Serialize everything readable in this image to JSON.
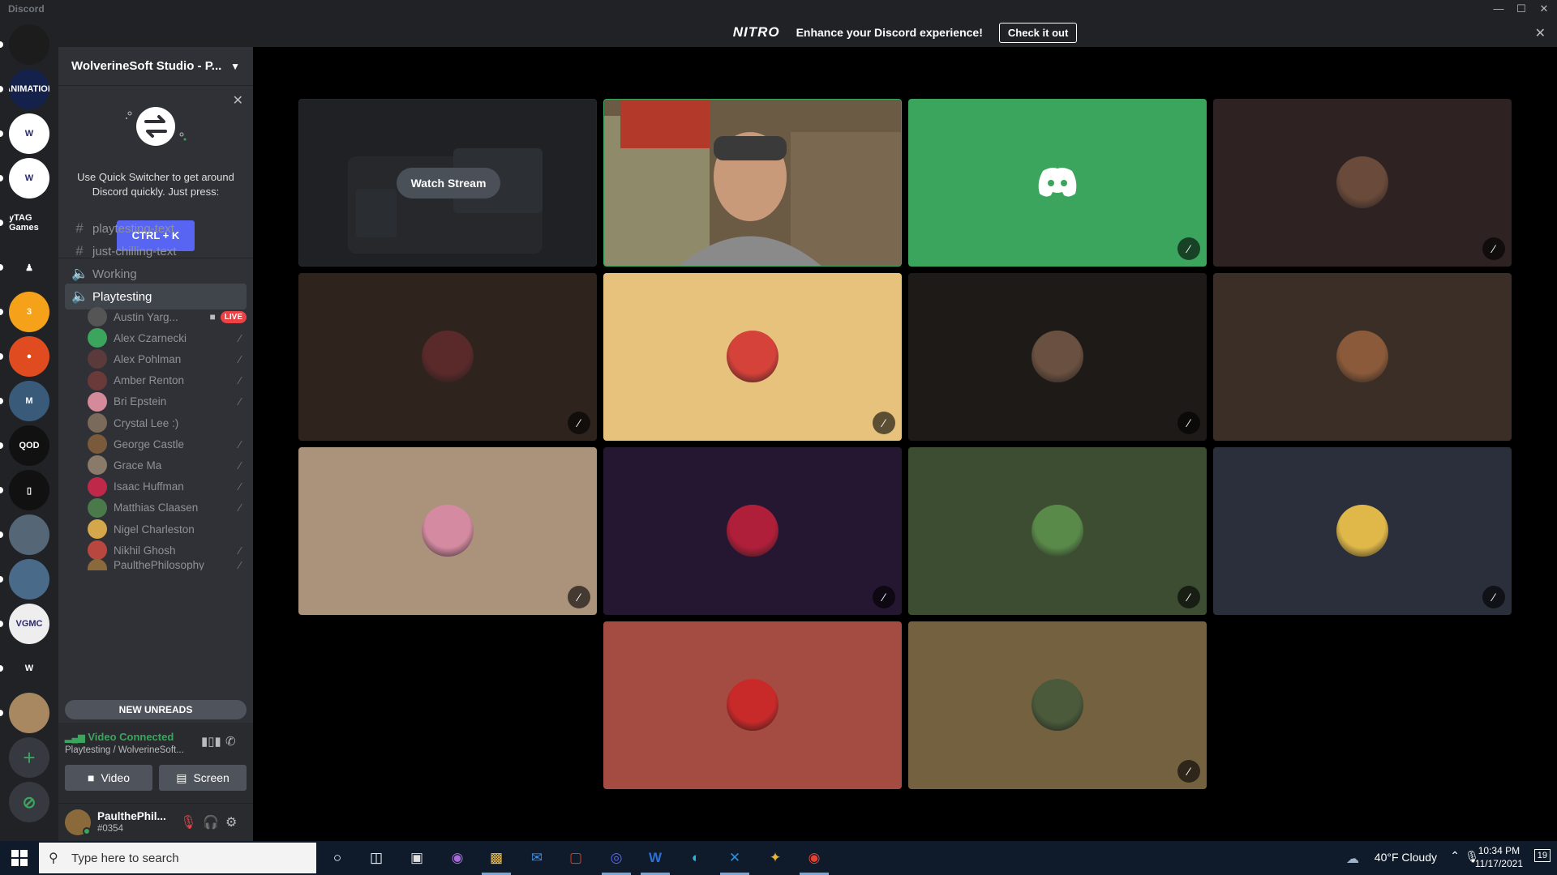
{
  "window": {
    "title": "Discord",
    "controls": [
      "—",
      "☐",
      "✕"
    ]
  },
  "nitro_banner": {
    "logo": "NITRO",
    "message": "Enhance your Discord experience!",
    "cta": "Check it out",
    "close": "✕"
  },
  "servers": [
    {
      "name": "server-1",
      "color": "#1c1c1c",
      "label": ""
    },
    {
      "name": "animation-club",
      "color": "#14214a",
      "label": "ANIMATION"
    },
    {
      "name": "wolverinesoft-1",
      "color": "#ffffff",
      "label": "W"
    },
    {
      "name": "wolverinesoft-2",
      "color": "#ffffff",
      "label": "W"
    },
    {
      "name": "ytag-games",
      "color": "#202225",
      "label": "yTAG Games"
    },
    {
      "name": "chess",
      "color": "#202225",
      "label": "♟"
    },
    {
      "name": "fire",
      "color": "#f5a21a",
      "label": "3"
    },
    {
      "name": "pizza",
      "color": "#e04b1f",
      "label": "●"
    },
    {
      "name": "michigan",
      "color": "#3a5a7a",
      "label": "M"
    },
    {
      "name": "pixel",
      "color": "#111111",
      "label": "QOD"
    },
    {
      "name": "frame",
      "color": "#111111",
      "label": "▯"
    },
    {
      "name": "photo",
      "color": "#556677",
      "label": ""
    },
    {
      "name": "mountain",
      "color": "#4a6a8a",
      "label": ""
    },
    {
      "name": "vgmc",
      "color": "#eeeeee",
      "label": "VGMC"
    },
    {
      "name": "w-blue",
      "color": "#202225",
      "label": "W"
    },
    {
      "name": "photo-2",
      "color": "#a88860",
      "label": ""
    }
  ],
  "rail_actions": {
    "add": "+",
    "explore": "⊘"
  },
  "sidebar": {
    "guild_name": "WolverineSoft Studio - P...",
    "quick_switcher": {
      "text": "Use Quick Switcher to get around Discord quickly. Just press:",
      "button": "CTRL + K"
    },
    "channels": [
      {
        "icon": "#",
        "type": "text",
        "name": "playtesting-text"
      },
      {
        "icon": "#",
        "type": "text",
        "name": "just-chilling-text"
      },
      {
        "icon": "🔈",
        "type": "voice",
        "name": "Working"
      },
      {
        "icon": "🔈",
        "type": "voice",
        "name": "Playtesting"
      }
    ],
    "voice_users": [
      {
        "name": "Austin Yarg...",
        "color": "#555555",
        "live": "LIVE"
      },
      {
        "name": "Alex Czarnecki",
        "color": "#3ba55d"
      },
      {
        "name": "Alex Pohlman",
        "color": "#5a3a3a"
      },
      {
        "name": "Amber Renton",
        "color": "#6a3a3a"
      },
      {
        "name": "Bri Epstein",
        "color": "#d48a9a"
      },
      {
        "name": "Crystal Lee :)",
        "color": "#7a6a5a"
      },
      {
        "name": "George Castle",
        "color": "#7a5a3a"
      },
      {
        "name": "Grace Ma",
        "color": "#8a7a6a"
      },
      {
        "name": "Isaac Huffman",
        "color": "#c0284a"
      },
      {
        "name": "Matthias Claasen",
        "color": "#4a7a4a"
      },
      {
        "name": "Nigel Charleston",
        "color": "#d4a84a"
      },
      {
        "name": "Nikhil Ghosh",
        "color": "#b8473f"
      },
      {
        "name": "PaulthePhilosophy",
        "color": "#8a6a3a"
      }
    ],
    "new_unreads": "NEW UNREADS",
    "rtc": {
      "status": "Video Connected",
      "channel": "Playtesting / WolverineSoft...",
      "video_button": "Video",
      "screen_button": "Screen"
    },
    "user": {
      "name": "PaulthePhil...",
      "tag": "#0354"
    }
  },
  "tiles": [
    {
      "kind": "stream",
      "label": "Watch Stream",
      "color": "#1f2124"
    },
    {
      "kind": "camera",
      "color": "#5a4a3a"
    },
    {
      "kind": "discord",
      "color": "#3ba55d",
      "muted": true
    },
    {
      "kind": "avatar",
      "color": "#2e2222",
      "avatar_color": "#6a4a3a",
      "muted": true
    },
    {
      "kind": "avatar",
      "color": "#2e231d",
      "avatar_color": "#5a2a2a",
      "muted": true
    },
    {
      "kind": "avatar",
      "color": "#e6c27d",
      "avatar_color": "#d4423a",
      "muted": true
    },
    {
      "kind": "avatar",
      "color": "#1e1a18",
      "avatar_color": "#6a5040",
      "muted": true
    },
    {
      "kind": "avatar",
      "color": "#3a2e27",
      "avatar_color": "#8a5a3a",
      "muted": false
    },
    {
      "kind": "avatar",
      "color": "#ab927b",
      "avatar_color": "#d48aa0",
      "muted": true
    },
    {
      "kind": "avatar",
      "color": "#251631",
      "avatar_color": "#b01f3a",
      "muted": true
    },
    {
      "kind": "avatar",
      "color": "#3d4d31",
      "avatar_color": "#5a8a4a",
      "muted": true
    },
    {
      "kind": "avatar",
      "color": "#2a2f3b",
      "avatar_color": "#e0b84a",
      "muted": true
    },
    {
      "kind": "avatar",
      "color": "#a54c42",
      "avatar_color": "#c82a2a",
      "muted": false
    },
    {
      "kind": "avatar",
      "color": "#74613f",
      "avatar_color": "#4a5a3a",
      "muted": true
    }
  ],
  "taskbar": {
    "search_placeholder": "Type here to search",
    "weather": "40°F  Cloudy",
    "time": "10:34 PM",
    "date": "11/17/2021",
    "notifications": "19"
  }
}
